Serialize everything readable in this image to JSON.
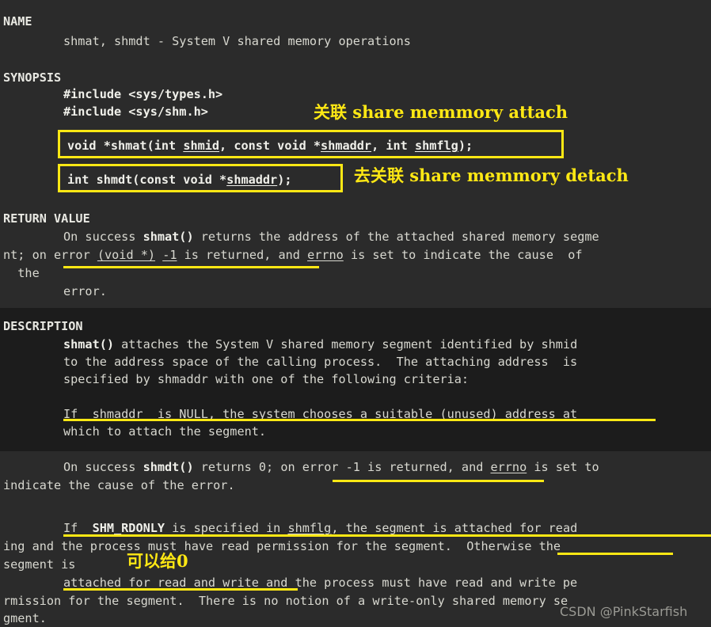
{
  "page": {
    "title": "shmat(2) man page - terminal view",
    "background": "#2b2b2b",
    "description_block_background": "#1c1c1c",
    "text_color": "#d8d8d0",
    "annotation_color": "#ffe814",
    "watermark_color": "#9a9a94"
  },
  "man": {
    "name_header": "NAME",
    "name_body": "shmat, shmdt - System V shared memory operations",
    "synopsis_header": "SYNOPSIS",
    "include_types": "#include <sys/types.h>",
    "include_shm": "#include <sys/shm.h>",
    "proto_shmat": "void *shmat(int shmid, const void *shmaddr, int shmflg);",
    "proto_shmat_parts": {
      "pre": "void *shmat(int ",
      "arg1": "shmid",
      "mid": ", const void *",
      "arg2": "shmaddr",
      "mid2": ", int ",
      "arg3": "shmflg",
      "post": ");"
    },
    "proto_shmdt": "int shmdt(const void *shmaddr);",
    "proto_shmdt_parts": {
      "pre": "int shmdt(const void *",
      "arg1": "shmaddr",
      "post": ");"
    },
    "return_header": "RETURN VALUE",
    "return_line1_pre": "On success ",
    "return_line1_bold": "shmat()",
    "return_line1_post": " returns the address of the attached shared memory segme",
    "return_line2_a": "nt; on error ",
    "return_line2_u1": "(void *)",
    "return_line2_b": " ",
    "return_line2_u2": "-1",
    "return_line2_c": " is returned, and ",
    "return_line2_u3": "errno",
    "return_line2_d": " is set to indicate the cause  of",
    "return_line3": "  the",
    "return_line4": "error.",
    "description_header": "DESCRIPTION",
    "desc_line1_bold": "shmat()",
    "desc_line1_rest": " attaches the System V shared memory segment identified by shmid",
    "desc_line2": "to the address space of the calling process.  The attaching address  is",
    "desc_line3": "specified by shmaddr with one of the following criteria:",
    "desc_line4": "If  shmaddr  is NULL, the system chooses a suitable (unused) address at",
    "desc_line5": "which to attach the segment.",
    "shmdt_line1_pre": "On success ",
    "shmdt_line1_bold": "shmdt()",
    "shmdt_line1_post": " returns 0; on error -1 is returned, and ",
    "shmdt_line1_u": "errno",
    "shmdt_line1_tail": " is set to",
    "shmdt_line2": "indicate the cause of the error.",
    "rdonly_line1_a": "If  ",
    "rdonly_line1_bold": "SHM_RDONLY",
    "rdonly_line1_b": " is specified in ",
    "rdonly_line1_u": "shmflg",
    "rdonly_line1_c": ", the segment is attached for read",
    "rdonly_line2": "ing and the process must have read permission for the segment.  Otherwise the",
    "rdonly_line3": "segment is",
    "rdonly_line4": "attached for read and write and the process must have read and write pe",
    "rdonly_line5": "rmission for the segment.  There is no notion of a write-only shared memory se",
    "rdonly_line6": "gment."
  },
  "annotations": {
    "attach_note": "关联 share memmory attach",
    "detach_note": "去关联 share memmory detach",
    "zero_note": "可以给0"
  },
  "watermark": {
    "text": "CSDN @PinkStarfish"
  }
}
